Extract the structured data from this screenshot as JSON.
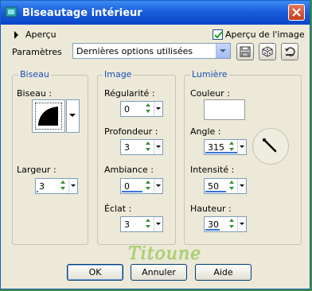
{
  "window": {
    "title": "Biseautage intérieur"
  },
  "top": {
    "preview_label": "Aperçu",
    "image_preview_label": "Aperçu de l'image",
    "image_preview_checked": true,
    "params_label": "Paramètres",
    "params_value": "Dernières options utilisées"
  },
  "bevel": {
    "group_title": "Biseau",
    "bevel_label": "Biseau :",
    "width_label": "Largeur :",
    "width_value": "3",
    "width_fill": 0.03
  },
  "image": {
    "group_title": "Image",
    "smoothness_label": "Régularité :",
    "smoothness_value": "0",
    "depth_label": "Profondeur :",
    "depth_value": "3",
    "ambience_label": "Ambiance :",
    "ambience_value": "0",
    "ambience_fill": 0.5,
    "shininess_label": "Éclat :",
    "shininess_value": "3"
  },
  "light": {
    "group_title": "Lumière",
    "color_label": "Couleur :",
    "color_value": "#ffffff",
    "angle_label": "Angle :",
    "angle_value": "315",
    "angle_fill": 0.875,
    "intensity_label": "Intensité :",
    "intensity_value": "50",
    "intensity_fill": 0.5,
    "height_label": "Hauteur :",
    "height_value": "30",
    "height_fill": 0.33
  },
  "watermark": "Titoune",
  "buttons": {
    "ok": "OK",
    "cancel": "Annuler",
    "help": "Aide"
  },
  "colors": {
    "title_bar": "#0b46c8",
    "dialog_bg": "#ece9d8",
    "group_title": "#1a4eb6",
    "spin_arrows": "#3a8a3a"
  }
}
